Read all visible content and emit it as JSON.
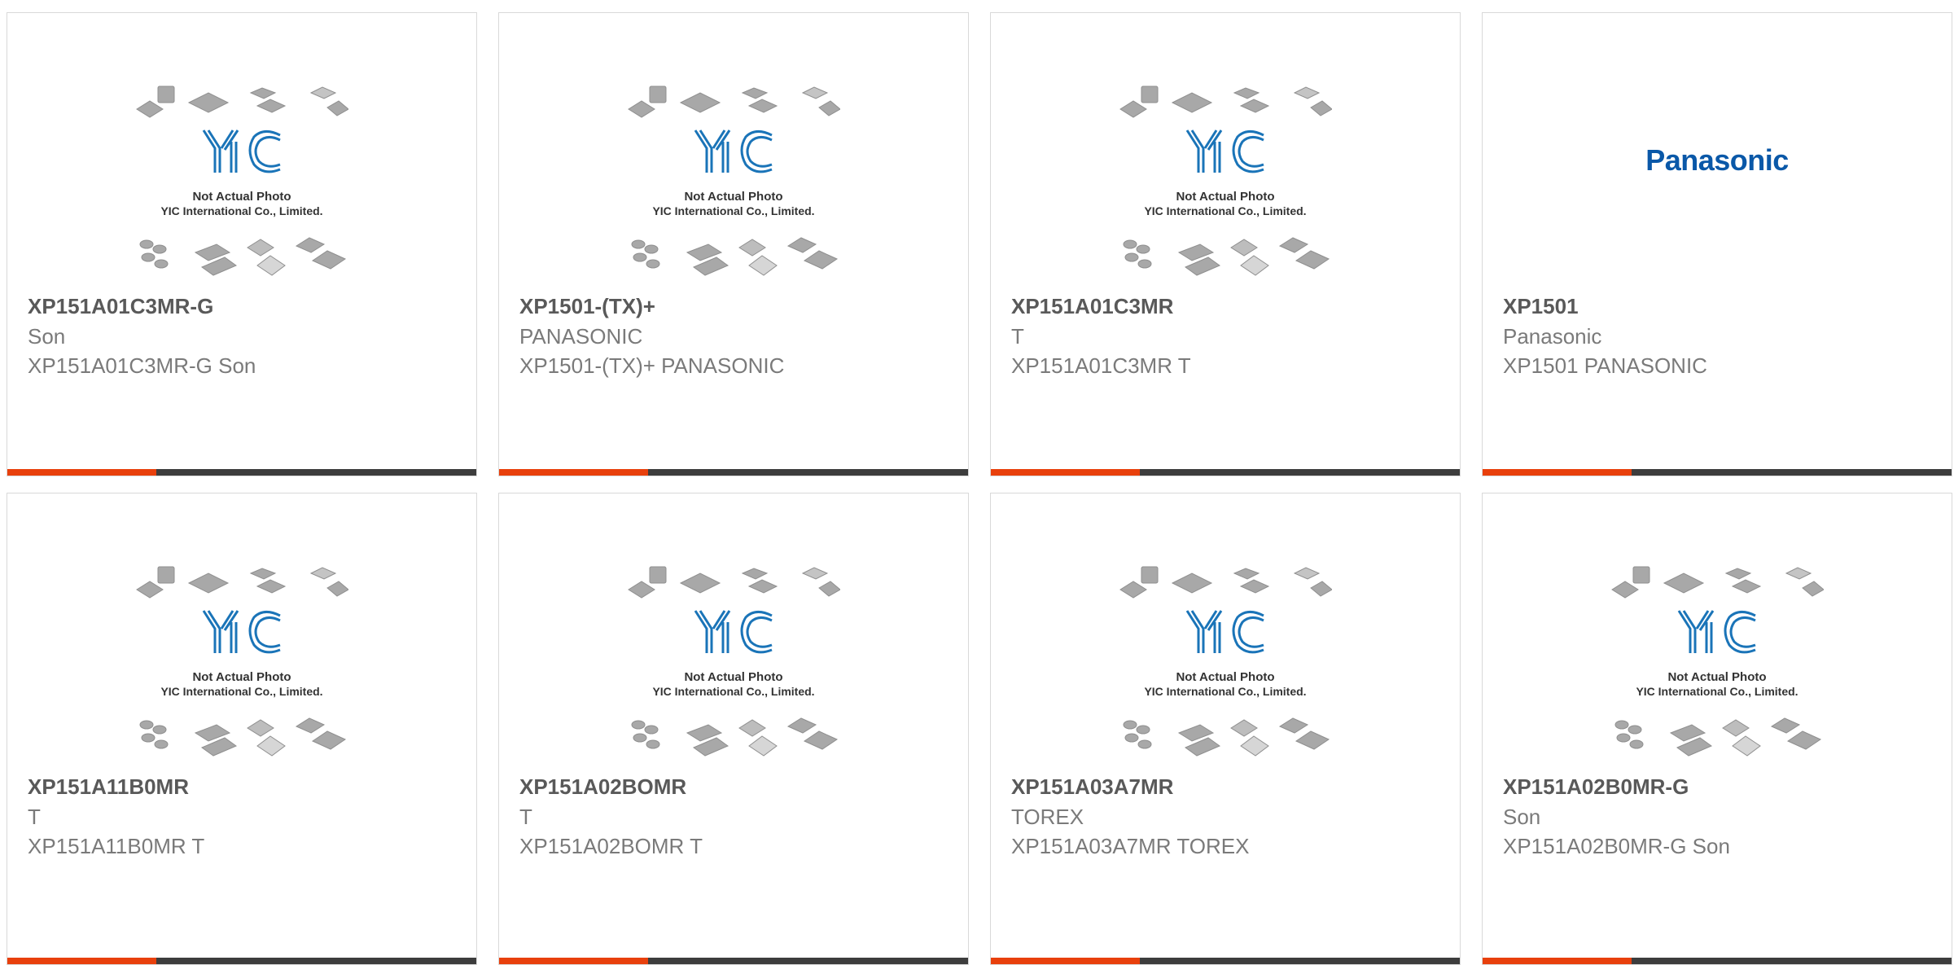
{
  "accent_color": "#e8400c",
  "bar_color": "#3d3d3d",
  "placeholder": {
    "caption_line1": "Not Actual Photo",
    "caption_line2": "YIC International Co., Limited.",
    "logo_text": "YIC"
  },
  "products": [
    {
      "part": "XP151A01C3MR-G",
      "manufacturer": "Son",
      "description": "XP151A01C3MR-G Son",
      "image": "yic-placeholder"
    },
    {
      "part": "XP1501-(TX)+",
      "manufacturer": "PANASONIC",
      "description": "XP1501-(TX)+ PANASONIC",
      "image": "yic-placeholder"
    },
    {
      "part": "XP151A01C3MR",
      "manufacturer": "T",
      "description": "XP151A01C3MR T",
      "image": "yic-placeholder"
    },
    {
      "part": "XP1501",
      "manufacturer": "Panasonic",
      "description": "XP1501 PANASONIC",
      "image": "brand-logo",
      "brand_logo_text": "Panasonic"
    },
    {
      "part": "XP151A11B0MR",
      "manufacturer": "T",
      "description": "XP151A11B0MR T",
      "image": "yic-placeholder"
    },
    {
      "part": "XP151A02BOMR",
      "manufacturer": "T",
      "description": "XP151A02BOMR T",
      "image": "yic-placeholder"
    },
    {
      "part": "XP151A03A7MR",
      "manufacturer": "TOREX",
      "description": "XP151A03A7MR TOREX",
      "image": "yic-placeholder"
    },
    {
      "part": "XP151A02B0MR-G",
      "manufacturer": "Son",
      "description": "XP151A02B0MR-G Son",
      "image": "yic-placeholder"
    }
  ]
}
